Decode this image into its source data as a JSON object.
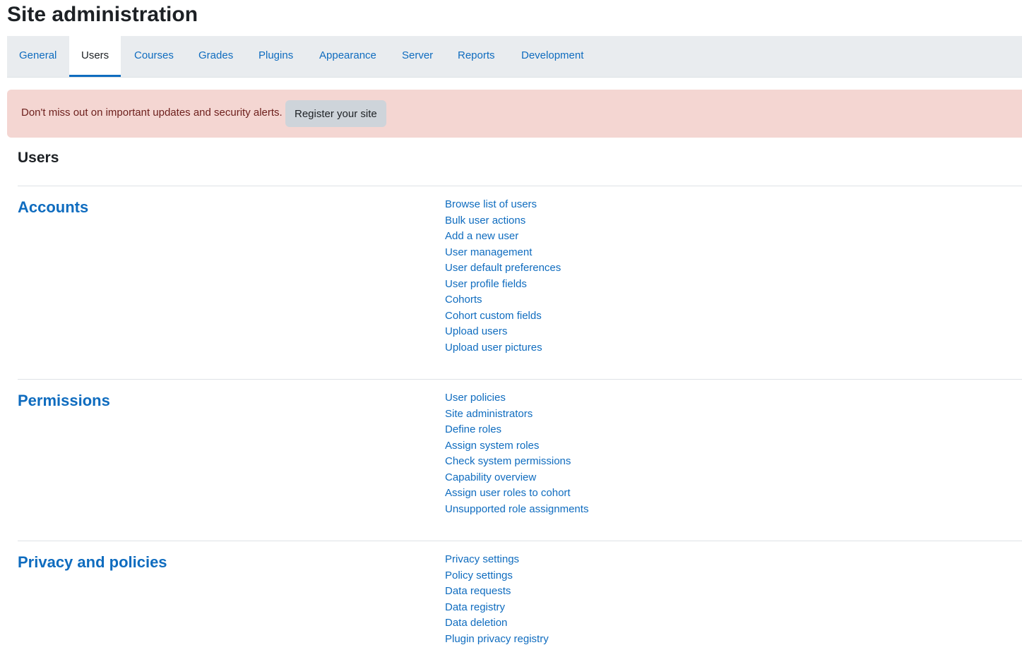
{
  "page_title": "Site administration",
  "tabs": [
    {
      "label": "General"
    },
    {
      "label": "Users",
      "active": true
    },
    {
      "label": "Courses"
    },
    {
      "label": "Grades"
    },
    {
      "label": "Plugins"
    },
    {
      "label": "Appearance"
    },
    {
      "label": "Server"
    },
    {
      "label": "Reports"
    },
    {
      "label": "Development"
    }
  ],
  "alert": {
    "message": "Don't miss out on important updates and security alerts.",
    "button_label": "Register your site"
  },
  "section_heading": "Users",
  "categories": [
    {
      "title": "Accounts",
      "links": [
        "Browse list of users",
        "Bulk user actions",
        "Add a new user",
        "User management",
        "User default preferences",
        "User profile fields",
        "Cohorts",
        "Cohort custom fields",
        "Upload users",
        "Upload user pictures"
      ]
    },
    {
      "title": "Permissions",
      "links": [
        "User policies",
        "Site administrators",
        "Define roles",
        "Assign system roles",
        "Check system permissions",
        "Capability overview",
        "Assign user roles to cohort",
        "Unsupported role assignments"
      ]
    },
    {
      "title": "Privacy and policies",
      "links": [
        "Privacy settings",
        "Policy settings",
        "Data requests",
        "Data registry",
        "Data deletion",
        "Plugin privacy registry"
      ]
    }
  ],
  "colors": {
    "link": "#0f6cbf",
    "tabbar_bg": "#e9ecef",
    "alert_bg": "#f4d6d2",
    "alert_text": "#6e211e",
    "button_bg": "#ced4da"
  }
}
